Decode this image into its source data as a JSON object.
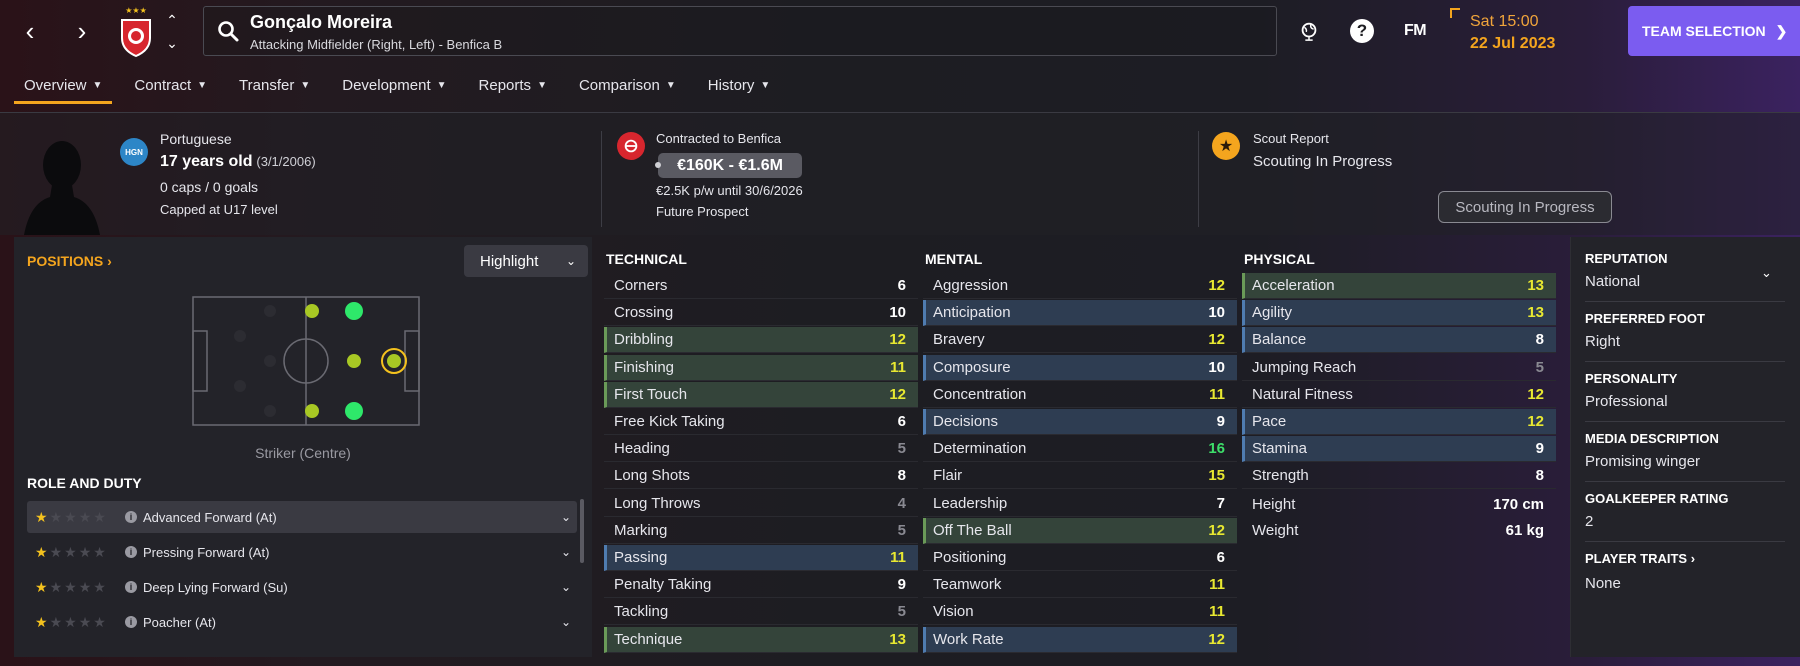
{
  "header": {
    "player_name": "Gonçalo Moreira",
    "player_subtitle": "Attacking Midfielder (Right, Left) - Benfica B",
    "date_day": "Sat 15:00",
    "date_date": "22 Jul 2023",
    "team_selection_label": "TEAM SELECTION",
    "fm_label": "FM",
    "help_label": "?"
  },
  "tabs": [
    {
      "label": "Overview"
    },
    {
      "label": "Contract"
    },
    {
      "label": "Transfer"
    },
    {
      "label": "Development"
    },
    {
      "label": "Reports"
    },
    {
      "label": "Comparison"
    },
    {
      "label": "History"
    }
  ],
  "info": {
    "nationality": "Portuguese",
    "nation_code": "HGN",
    "age": "17 years old",
    "dob": "(3/1/2006)",
    "caps": "0 caps / 0 goals",
    "capped_level": "Capped at U17 level",
    "contract_title": "Contracted to Benfica",
    "value_range": "€160K - €1.6M",
    "wage": "€2.5K p/w until 30/6/2026",
    "prospect": "Future Prospect",
    "scout_title": "Scout Report",
    "scout_status": "Scouting In Progress",
    "scout_button": "Scouting In Progress"
  },
  "positions": {
    "title": "POSITIONS",
    "highlight_label": "Highlight",
    "caption": "Striker (Centre)"
  },
  "roles": {
    "title": "ROLE AND DUTY",
    "items": [
      {
        "label": "Advanced Forward (At)",
        "stars": 1
      },
      {
        "label": "Pressing Forward (At)",
        "stars": 1
      },
      {
        "label": "Deep Lying Forward (Su)",
        "stars": 1
      },
      {
        "label": "Poacher (At)",
        "stars": 1
      }
    ]
  },
  "technical": {
    "title": "TECHNICAL",
    "rows": [
      {
        "name": "Corners",
        "value": "6",
        "hl": "",
        "color": "white"
      },
      {
        "name": "Crossing",
        "value": "10",
        "hl": "",
        "color": "white"
      },
      {
        "name": "Dribbling",
        "value": "12",
        "hl": "green",
        "color": "yellow"
      },
      {
        "name": "Finishing",
        "value": "11",
        "hl": "green",
        "color": "yellow"
      },
      {
        "name": "First Touch",
        "value": "12",
        "hl": "green",
        "color": "yellow"
      },
      {
        "name": "Free Kick Taking",
        "value": "6",
        "hl": "",
        "color": "white"
      },
      {
        "name": "Heading",
        "value": "5",
        "hl": "",
        "color": "grey"
      },
      {
        "name": "Long Shots",
        "value": "8",
        "hl": "",
        "color": "white"
      },
      {
        "name": "Long Throws",
        "value": "4",
        "hl": "",
        "color": "grey"
      },
      {
        "name": "Marking",
        "value": "5",
        "hl": "",
        "color": "grey"
      },
      {
        "name": "Passing",
        "value": "11",
        "hl": "blue",
        "color": "yellow"
      },
      {
        "name": "Penalty Taking",
        "value": "9",
        "hl": "",
        "color": "white"
      },
      {
        "name": "Tackling",
        "value": "5",
        "hl": "",
        "color": "grey"
      },
      {
        "name": "Technique",
        "value": "13",
        "hl": "green",
        "color": "yellow"
      }
    ]
  },
  "mental": {
    "title": "MENTAL",
    "rows": [
      {
        "name": "Aggression",
        "value": "12",
        "hl": "",
        "color": "yellow"
      },
      {
        "name": "Anticipation",
        "value": "10",
        "hl": "blue",
        "color": "white"
      },
      {
        "name": "Bravery",
        "value": "12",
        "hl": "",
        "color": "yellow"
      },
      {
        "name": "Composure",
        "value": "10",
        "hl": "blue",
        "color": "white"
      },
      {
        "name": "Concentration",
        "value": "11",
        "hl": "",
        "color": "yellow"
      },
      {
        "name": "Decisions",
        "value": "9",
        "hl": "blue",
        "color": "white"
      },
      {
        "name": "Determination",
        "value": "16",
        "hl": "",
        "color": "green"
      },
      {
        "name": "Flair",
        "value": "15",
        "hl": "",
        "color": "yellow"
      },
      {
        "name": "Leadership",
        "value": "7",
        "hl": "",
        "color": "white"
      },
      {
        "name": "Off The Ball",
        "value": "12",
        "hl": "green",
        "color": "yellow"
      },
      {
        "name": "Positioning",
        "value": "6",
        "hl": "",
        "color": "white"
      },
      {
        "name": "Teamwork",
        "value": "11",
        "hl": "",
        "color": "yellow"
      },
      {
        "name": "Vision",
        "value": "11",
        "hl": "",
        "color": "yellow"
      },
      {
        "name": "Work Rate",
        "value": "12",
        "hl": "blue",
        "color": "yellow"
      }
    ]
  },
  "physical": {
    "title": "PHYSICAL",
    "rows": [
      {
        "name": "Acceleration",
        "value": "13",
        "hl": "green",
        "color": "yellow"
      },
      {
        "name": "Agility",
        "value": "13",
        "hl": "blue",
        "color": "yellow"
      },
      {
        "name": "Balance",
        "value": "8",
        "hl": "blue",
        "color": "white"
      },
      {
        "name": "Jumping Reach",
        "value": "5",
        "hl": "",
        "color": "grey"
      },
      {
        "name": "Natural Fitness",
        "value": "12",
        "hl": "",
        "color": "yellow"
      },
      {
        "name": "Pace",
        "value": "12",
        "hl": "blue",
        "color": "yellow"
      },
      {
        "name": "Stamina",
        "value": "9",
        "hl": "blue",
        "color": "white"
      },
      {
        "name": "Strength",
        "value": "8",
        "hl": "",
        "color": "white"
      }
    ],
    "height_label": "Height",
    "height_value": "170 cm",
    "weight_label": "Weight",
    "weight_value": "61 kg"
  },
  "side": {
    "reputation_label": "REPUTATION",
    "reputation_value": "National",
    "foot_label": "PREFERRED FOOT",
    "foot_value": "Right",
    "personality_label": "PERSONALITY",
    "personality_value": "Professional",
    "media_label": "MEDIA DESCRIPTION",
    "media_value": "Promising winger",
    "gk_label": "GOALKEEPER RATING",
    "gk_value": "2",
    "traits_label": "PLAYER TRAITS",
    "traits_value": "None"
  },
  "colors": {
    "accent": "#f4a51e",
    "team_selection": "#7b5cf0",
    "highlight_green": "#34443a",
    "highlight_blue": "#2e3d52"
  }
}
